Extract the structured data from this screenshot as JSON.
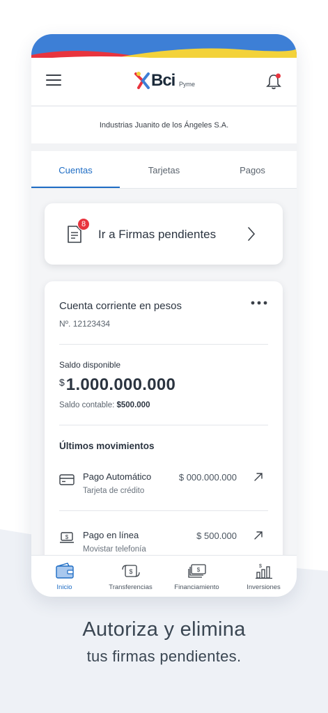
{
  "header": {
    "logo_text": "Bci",
    "logo_sub": "Pyme",
    "company_name": "Industrias Juanito de los Ángeles S.A."
  },
  "tabs": [
    {
      "label": "Cuentas",
      "active": true
    },
    {
      "label": "Tarjetas",
      "active": false
    },
    {
      "label": "Pagos",
      "active": false
    }
  ],
  "firmas": {
    "label": "Ir a Firmas pendientes",
    "badge": "8"
  },
  "account": {
    "title": "Cuenta corriente en pesos",
    "number": "Nº. 12123434",
    "saldo_label": "Saldo disponible",
    "currency": "$",
    "saldo_value": "1.000.000.000",
    "contable_label": "Saldo contable:",
    "contable_value": "$500.000",
    "movements_title": "Últimos movimientos",
    "movements": [
      {
        "name": "Pago Automático",
        "sub": "Tarjeta de crédito",
        "amount": "$ 000.000.000",
        "icon": "credit-card-icon"
      },
      {
        "name": "Pago en línea",
        "sub": "Movistar telefonía",
        "amount": "$ 500.000",
        "icon": "laptop-payment-icon"
      }
    ]
  },
  "bottom_nav": [
    {
      "label": "Inicio",
      "icon": "wallet-icon",
      "active": true
    },
    {
      "label": "Transferencias",
      "icon": "transfer-icon",
      "active": false
    },
    {
      "label": "Financiamiento",
      "icon": "cash-stack-icon",
      "active": false
    },
    {
      "label": "Inversiones",
      "icon": "growth-bars-icon",
      "active": false
    }
  ],
  "promo": {
    "headline": "Autoriza y elimina",
    "subline": "tus firmas pendientes."
  },
  "colors": {
    "accent": "#1d6cc4",
    "badge": "#e8343e",
    "wave_blue": "#3d7fd6",
    "wave_red": "#e8343e",
    "wave_yellow": "#f3d23a"
  }
}
